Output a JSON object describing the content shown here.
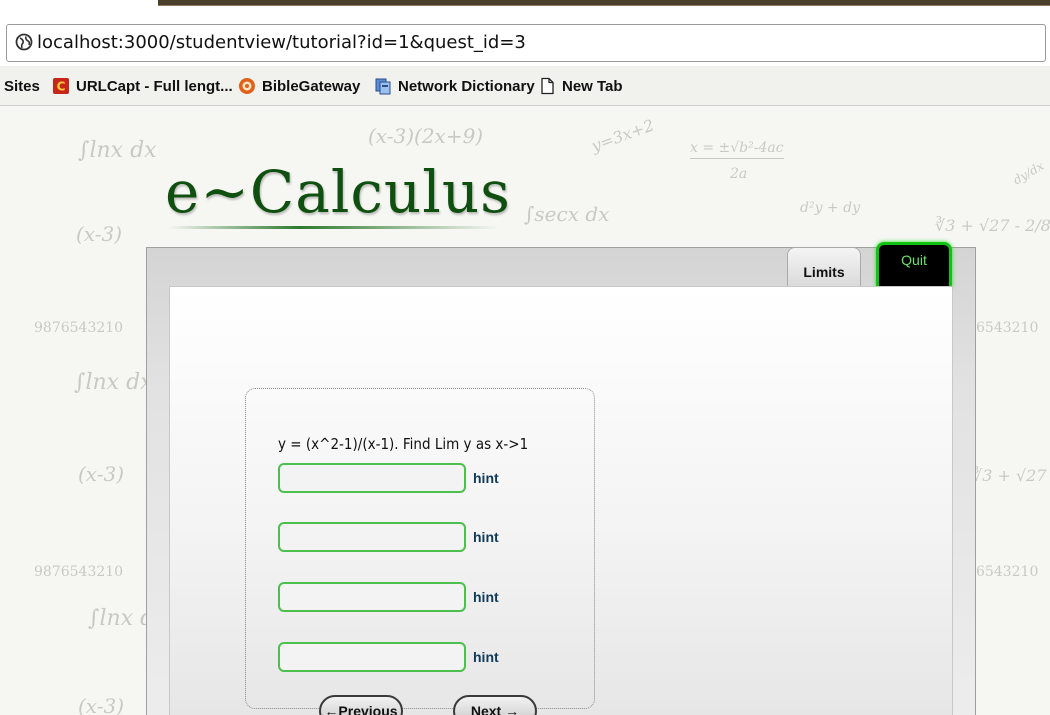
{
  "browser": {
    "url": "localhost:3000/studentview/tutorial?id=1&quest_id=3",
    "bookmarks": [
      {
        "label": "Sites",
        "icon": "none"
      },
      {
        "label": "URLCapt - Full lengt...",
        "icon": "urlcapt-icon"
      },
      {
        "label": "BibleGateway",
        "icon": "biblegateway-icon"
      },
      {
        "label": "Network Dictionary",
        "icon": "network-dictionary-icon"
      },
      {
        "label": "New Tab",
        "icon": "page-icon"
      }
    ]
  },
  "site": {
    "logo": "e~Calculus",
    "background_doodles": [
      "∫lnx dx",
      "(x-3)(2x+9)",
      "y=3x+2",
      "x = ±√b²-4ac",
      "2a",
      "(x-3)",
      "∫secx dx",
      "d²y + dy",
      "∛3 + √27 - 2/8",
      "9876543210",
      "6543210",
      "dy/dx"
    ]
  },
  "tabs": {
    "limits": "Limits",
    "quit": "Quit"
  },
  "question": {
    "text": "y = (x^2-1)/(x-1). Find Lim y as x->1",
    "answers": [
      {
        "value": "",
        "hint_label": "hint"
      },
      {
        "value": "",
        "hint_label": "hint"
      },
      {
        "value": "",
        "hint_label": "hint"
      },
      {
        "value": "",
        "hint_label": "hint"
      }
    ]
  },
  "navigation": {
    "previous_label": "←Previous",
    "next_label": "Next →"
  },
  "colors": {
    "logo": "#0f4f0f",
    "input_border": "#4cbf4c",
    "quit_border": "#11c211",
    "hint": "#0e3b5c"
  }
}
